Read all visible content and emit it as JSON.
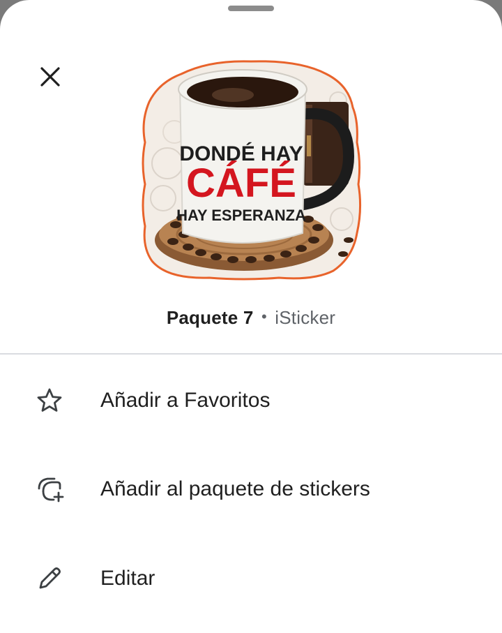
{
  "sheet": {
    "close_icon": "close-icon",
    "sticker": {
      "description_lines": [
        "DONDÉ HAY",
        "CÁFÉ",
        "HAY ESPERANZA"
      ],
      "outline_color": "#e8632b"
    },
    "pack": {
      "name": "Paquete 7",
      "separator": "•",
      "source": "iSticker"
    },
    "menu": [
      {
        "label": "Añadir a Favoritos",
        "icon": "star-outline-icon"
      },
      {
        "label": "Añadir al paquete de stickers",
        "icon": "add-sticker-pack-icon"
      },
      {
        "label": "Editar",
        "icon": "pencil-icon"
      }
    ]
  }
}
